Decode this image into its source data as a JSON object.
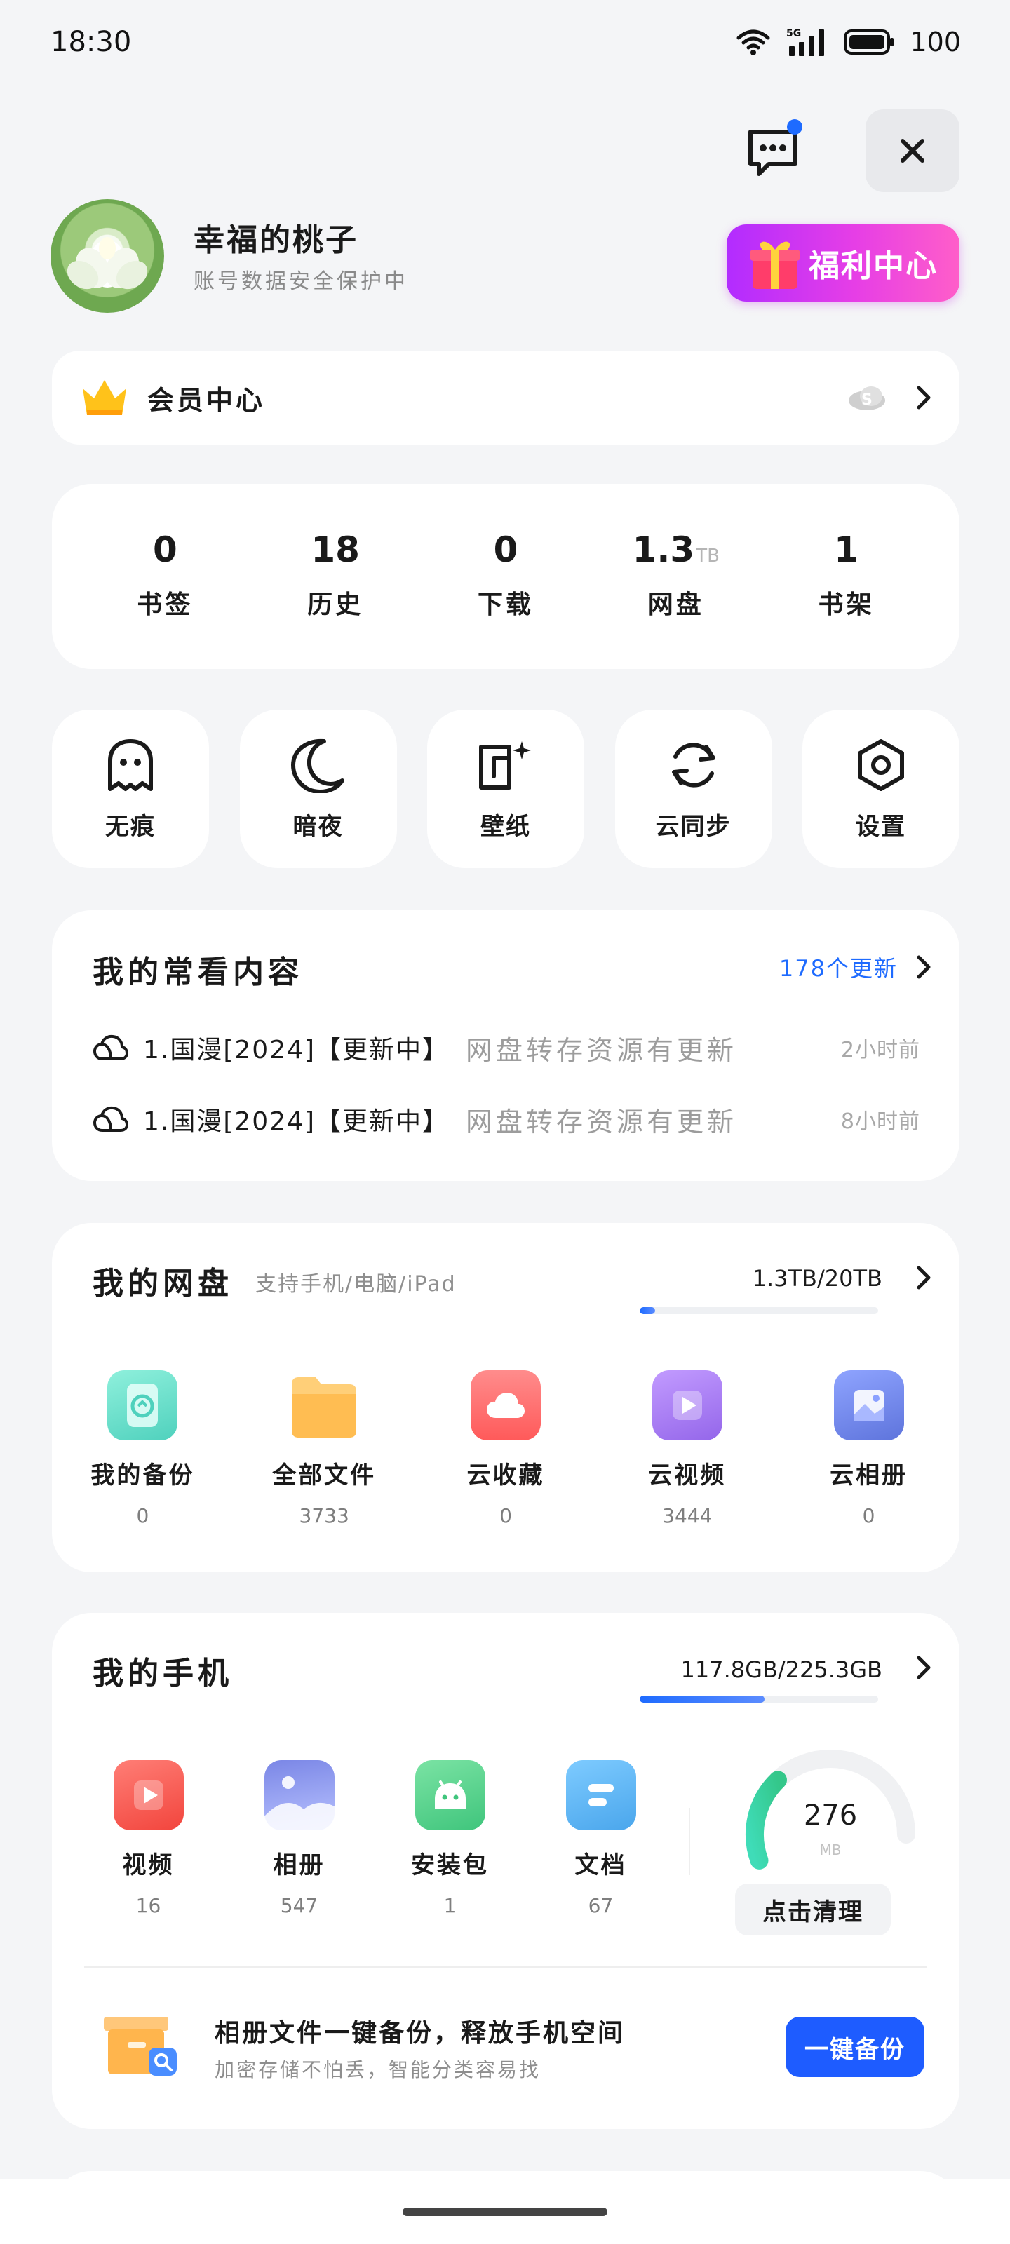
{
  "status_bar": {
    "time": "18:30",
    "network": "5G",
    "battery": "100"
  },
  "profile": {
    "name": "幸福的桃子",
    "subtitle": "账号数据安全保护中",
    "welfare_label": "福利中心"
  },
  "vip": {
    "title": "会员中心"
  },
  "stats": [
    {
      "value": "0",
      "unit": "",
      "label": "书签"
    },
    {
      "value": "18",
      "unit": "",
      "label": "历史"
    },
    {
      "value": "0",
      "unit": "",
      "label": "下载"
    },
    {
      "value": "1.3",
      "unit": "TB",
      "label": "网盘"
    },
    {
      "value": "1",
      "unit": "",
      "label": "书架"
    }
  ],
  "tools": [
    {
      "label": "无痕",
      "icon": "ghost-icon"
    },
    {
      "label": "暗夜",
      "icon": "moon-icon"
    },
    {
      "label": "壁纸",
      "icon": "wallpaper-icon"
    },
    {
      "label": "云同步",
      "icon": "sync-icon"
    },
    {
      "label": "设置",
      "icon": "settings-icon"
    }
  ],
  "recent": {
    "title": "我的常看内容",
    "more_label": "178个更新",
    "items": [
      {
        "name": "1.国漫[2024]【更新中】",
        "desc": "网盘转存资源有更新",
        "time": "2小时前"
      },
      {
        "name": "1.国漫[2024]【更新中】",
        "desc": "网盘转存资源有更新",
        "time": "8小时前"
      }
    ]
  },
  "disk": {
    "title": "我的网盘",
    "subtitle": "支持手机/电脑/iPad",
    "usage": "1.3TB/20TB",
    "usage_fraction": 0.065,
    "items": [
      {
        "label": "我的备份",
        "count": "0",
        "icon": "backup-icon",
        "color": "#5fd6c3"
      },
      {
        "label": "全部文件",
        "count": "3733",
        "icon": "folder-icon",
        "color": "#ffc562"
      },
      {
        "label": "云收藏",
        "count": "0",
        "icon": "cloud-favorite-icon",
        "color": "#ff6b6b"
      },
      {
        "label": "云视频",
        "count": "3444",
        "icon": "cloud-video-icon",
        "color": "#a97cf0"
      },
      {
        "label": "云相册",
        "count": "0",
        "icon": "cloud-album-icon",
        "color": "#6f86e8"
      }
    ]
  },
  "phone": {
    "title": "我的手机",
    "usage": "117.8GB/225.3GB",
    "usage_fraction": 0.523,
    "items": [
      {
        "label": "视频",
        "count": "16",
        "icon": "video-icon",
        "color": "#ff5b52"
      },
      {
        "label": "相册",
        "count": "547",
        "icon": "album-icon",
        "color": "#7a8ae6"
      },
      {
        "label": "安装包",
        "count": "1",
        "icon": "android-icon",
        "color": "#4fd08a"
      },
      {
        "label": "文档",
        "count": "67",
        "icon": "document-icon",
        "color": "#58b6f2"
      }
    ],
    "junk_value": "276",
    "junk_unit": "MB",
    "junk_fraction": 0.3,
    "clean_label": "点击清理",
    "backup_title": "相册文件一键备份，释放手机空间",
    "backup_subtitle": "加密存储不怕丢，智能分类容易找",
    "backup_button": "一键备份"
  }
}
